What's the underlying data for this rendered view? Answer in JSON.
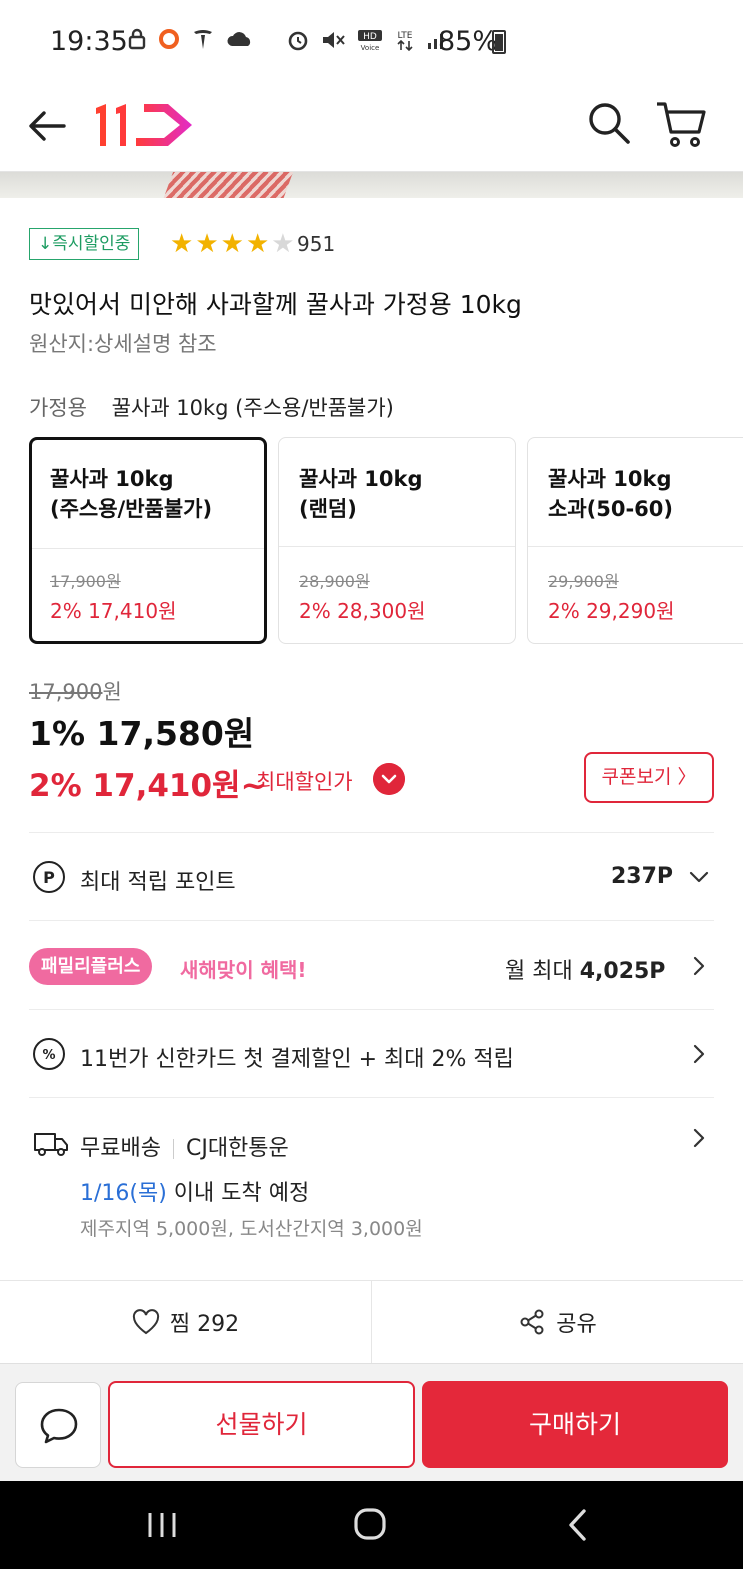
{
  "status_bar": {
    "time": "19:35",
    "battery": "85%",
    "icons": [
      "lock-icon",
      "circle-icon",
      "tesla-icon",
      "cloud-icon",
      "alarm-icon",
      "mute-icon",
      "hd-voice-icon",
      "lte-icon",
      "signal-icon",
      "battery-icon"
    ]
  },
  "header": {
    "logo_text": "11",
    "icons": [
      "back-arrow-icon",
      "search-icon",
      "cart-icon"
    ]
  },
  "product": {
    "badge": "↓즉시할인중",
    "rating_stars": 4,
    "review_count": "951",
    "title": "맛있어서 미안해 사과할께 꿀사과 가정용 10kg",
    "origin": "원산지:상세설명 참조",
    "option_label": "가정용",
    "option_value": "꿀사과 10kg (주스용/반품불가)"
  },
  "options": [
    {
      "name": "꿀사과 10kg\n(주스용/반품불가)",
      "orig": "17,900원",
      "sale": "2% 17,410원",
      "selected": true
    },
    {
      "name": "꿀사과 10kg\n(랜덤)",
      "orig": "28,900원",
      "sale": "2% 28,300원",
      "selected": false
    },
    {
      "name": "꿀사과 10kg\n소과(50-60)",
      "orig": "29,900원",
      "sale": "2% 29,290원",
      "selected": false
    }
  ],
  "price": {
    "original_num": "17,900",
    "original_unit": "원",
    "main": "1% 17,580원",
    "max": "2% 17,410원~",
    "max_label": "최대할인가",
    "coupon_label": "쿠폰보기"
  },
  "points": {
    "label": "최대 적립 포인트",
    "value": "237P"
  },
  "family": {
    "pill": "패밀리플러스",
    "text": "새해맞이 혜택!",
    "right_label": "월 최대",
    "right_value": "4,025P"
  },
  "card_promo": {
    "text": "11번가 신한카드 첫 결제할인 + 최대 2% 적립"
  },
  "shipping": {
    "type": "무료배송",
    "carrier": "CJ대한통운",
    "date": "1/16(목)",
    "arrival": " 이내 도착 예정",
    "note": "제주지역 5,000원, 도서산간지역 3,000원"
  },
  "actions": {
    "like_label": "찜",
    "like_count": "292",
    "share_label": "공유",
    "gift_label": "선물하기",
    "buy_label": "구매하기"
  },
  "colors": {
    "brand_red": "#e0263a",
    "green_badge": "#1e9c62",
    "pink": "#f06aa0",
    "star": "#f2b200",
    "date_blue": "#2a6fd6"
  }
}
